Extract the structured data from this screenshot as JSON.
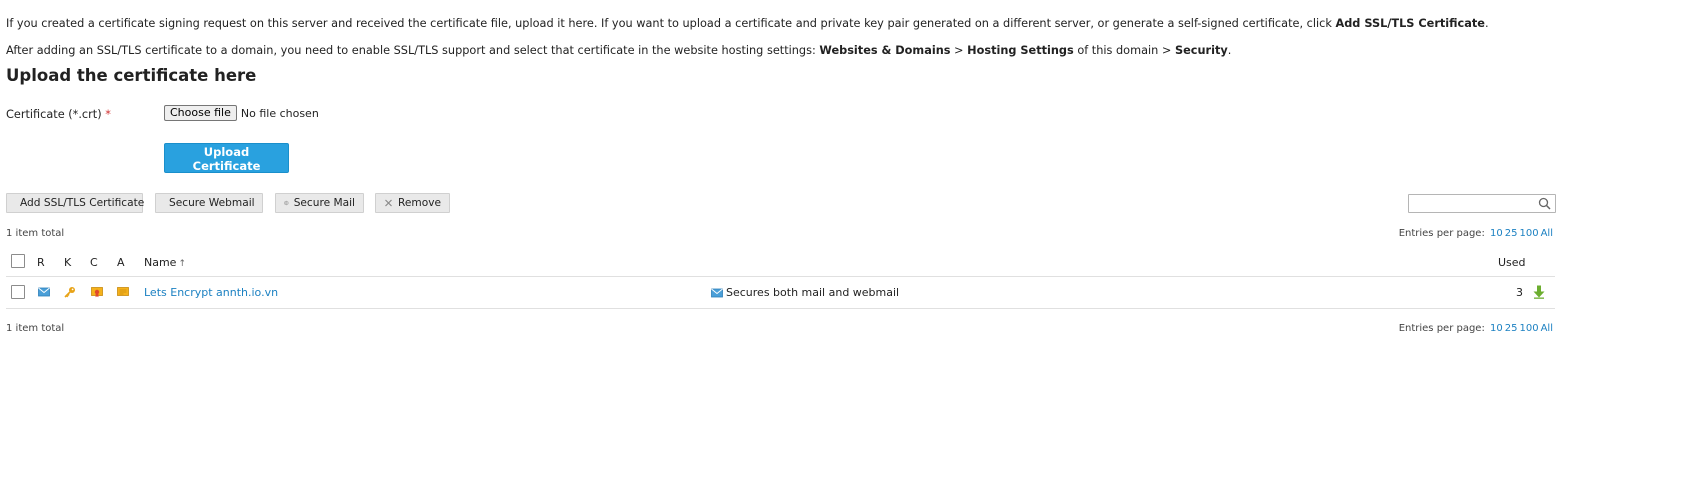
{
  "intro": {
    "line1_text": "If you created a certificate signing request on this server and received the certificate file, upload it here. If you want to upload a certificate and private key pair generated on a different server, or generate a self-signed certificate, click ",
    "line1_bold": "Add SSL/TLS Certificate",
    "line1_end": ".",
    "line2_text": "After adding an SSL/TLS certificate to a domain, you need to enable SSL/TLS support and select that certificate in the website hosting settings: ",
    "line2_bold1": "Websites & Domains",
    "line2_sep1": " > ",
    "line2_bold2": "Hosting Settings",
    "line2_mid": " of this domain > ",
    "line2_bold3": "Security",
    "line2_end": "."
  },
  "upload_section": {
    "title": "Upload the certificate here",
    "certificate_label": "Certificate (*.crt)",
    "required_mark": "*",
    "choose_file_label": "Choose file",
    "file_status": "No file chosen",
    "upload_button": "Upload Certificate"
  },
  "toolbar": {
    "add_label": "Add SSL/TLS Certificate",
    "secure_webmail_label": "Secure Webmail",
    "secure_mail_label": "Secure Mail",
    "remove_label": "Remove",
    "search_value": ""
  },
  "list": {
    "total_text": "1 item total",
    "entries_label": "Entries per page:",
    "entries_options": [
      "10",
      "25",
      "100",
      "All"
    ],
    "columns": {
      "r": "R",
      "k": "K",
      "c": "C",
      "a": "A",
      "name": "Name",
      "sort_indicator": "↑",
      "used": "Used"
    },
    "rows": [
      {
        "name": "Lets Encrypt annth.io.vn",
        "secures": "Secures both mail and webmail",
        "used": "3",
        "icons": [
          "mail-icon",
          "key-icon",
          "certificate-icon",
          "ca-certificate-icon"
        ]
      }
    ]
  },
  "colors": {
    "accent": "#29a1df",
    "link": "#1c81c2",
    "required": "#d02d2d",
    "download_green": "#6cae2f",
    "key_yellow": "#e8a317"
  }
}
